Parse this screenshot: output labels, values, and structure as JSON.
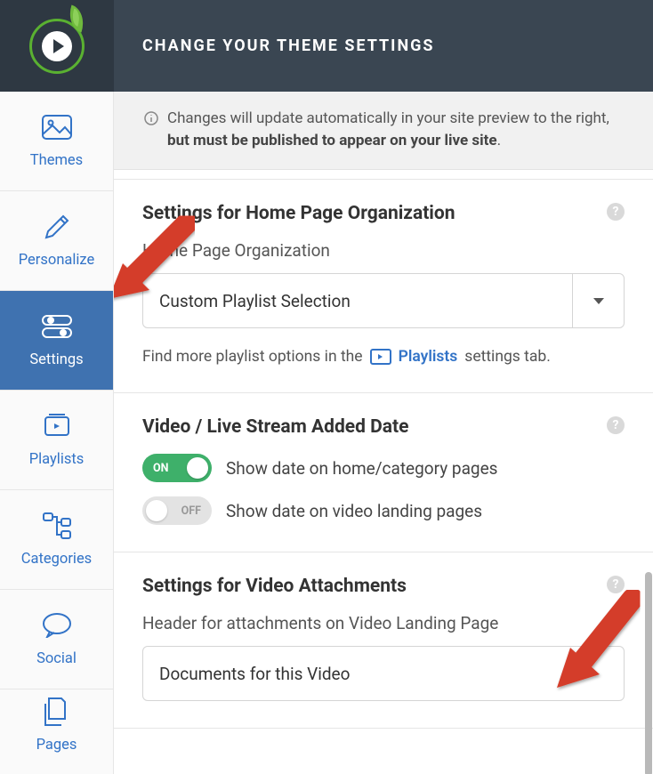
{
  "header": {
    "title": "CHANGE YOUR THEME SETTINGS"
  },
  "sidebar": {
    "items": [
      {
        "label": "Themes",
        "name": "sidebar-item-themes",
        "active": false
      },
      {
        "label": "Personalize",
        "name": "sidebar-item-personalize",
        "active": false
      },
      {
        "label": "Settings",
        "name": "sidebar-item-settings",
        "active": true
      },
      {
        "label": "Playlists",
        "name": "sidebar-item-playlists",
        "active": false
      },
      {
        "label": "Categories",
        "name": "sidebar-item-categories",
        "active": false
      },
      {
        "label": "Social",
        "name": "sidebar-item-social",
        "active": false
      },
      {
        "label": "Pages",
        "name": "sidebar-item-pages",
        "active": false
      }
    ]
  },
  "info_bar": {
    "text_a": "Changes will update automatically in your site preview to the right, ",
    "text_b": "but must be published to appear on your live site",
    "text_c": "."
  },
  "sections": {
    "home_org": {
      "heading": "Settings for Home Page Organization",
      "field_label": "Home Page Organization",
      "select_value": "Custom Playlist Selection",
      "hint_a": "Find more playlist options in the",
      "hint_link": "Playlists",
      "hint_b": "settings tab."
    },
    "video_date": {
      "heading": "Video / Live Stream Added Date",
      "toggle1": {
        "state": "ON",
        "label": "Show date on home/category pages"
      },
      "toggle2": {
        "state": "OFF",
        "label": "Show date on video landing pages"
      }
    },
    "attachments": {
      "heading": "Settings for Video Attachments",
      "field_label": "Header for attachments on Video Landing Page",
      "input_value": "Documents for this Video"
    }
  },
  "colors": {
    "accent": "#3273c7",
    "header_bg": "#3a4652",
    "sidebar_active": "#3f72b0",
    "toggle_on": "#3eb06a",
    "arrow": "#d43e2a"
  }
}
